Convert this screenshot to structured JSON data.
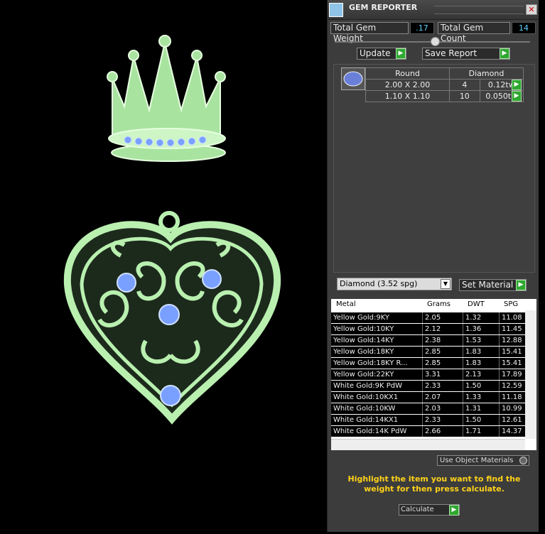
{
  "window": {
    "title": "GEM REPORTER"
  },
  "stats": {
    "weight_label": "Total Gem Weight",
    "weight_value": ".17",
    "count_label": "Total Gem Count",
    "count_value": "14"
  },
  "toolbar": {
    "update_label": "Update",
    "save_label": "Save Report"
  },
  "gems": {
    "header": [
      "Round",
      "Diamond"
    ],
    "rows": [
      {
        "size": "2.00 X 2.00",
        "count": "4",
        "weight": "0.12tw"
      },
      {
        "size": "1.10 X 1.10",
        "count": "10",
        "weight": "0.050tw"
      }
    ]
  },
  "material": {
    "selected": "Diamond    (3.52 spg)",
    "set_label": "Set Material"
  },
  "metals": {
    "columns": [
      "Metal",
      "Grams",
      "DWT",
      "SPG"
    ],
    "rows": [
      [
        "Yellow Gold:9KY",
        "2.05",
        "1.32",
        "11.08"
      ],
      [
        "Yellow Gold:10KY",
        "2.12",
        "1.36",
        "11.45"
      ],
      [
        "Yellow Gold:14KY",
        "2.38",
        "1.53",
        "12.88"
      ],
      [
        "Yellow Gold:18KY",
        "2.85",
        "1.83",
        "15.41"
      ],
      [
        "Yellow Gold:18KY R...",
        "2.85",
        "1.83",
        "15.41"
      ],
      [
        "Yellow Gold:22KY",
        "3.31",
        "2.13",
        "17.89"
      ],
      [
        "White Gold:9K PdW",
        "2.33",
        "1.50",
        "12.59"
      ],
      [
        "White Gold:10KX1",
        "2.07",
        "1.33",
        "11.18"
      ],
      [
        "White Gold:10KW",
        "2.03",
        "1.31",
        "10.99"
      ],
      [
        "White Gold:14KX1",
        "2.33",
        "1.50",
        "12.61"
      ],
      [
        "White Gold:14K PdW",
        "2.66",
        "1.71",
        "14.37"
      ]
    ]
  },
  "use_object_materials": "Use Object Materials",
  "hint": "Highlight the item you want to find the weight for then press calculate.",
  "calculate_label": "Calculate",
  "colors": {
    "model_green": "#b9f0b0",
    "gem_blue": "#7aa0ff",
    "accent_yellow": "#ffd21a",
    "go_green": "#2fa82f"
  }
}
